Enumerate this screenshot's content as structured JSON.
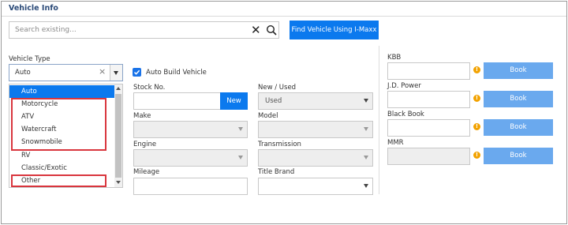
{
  "header": {
    "title": "Vehicle Info"
  },
  "search": {
    "placeholder": "Search existing...",
    "value": "",
    "find_button": "Find Vehicle Using I-Maxx"
  },
  "vehicle_type": {
    "label": "Vehicle Type",
    "selected": "Auto",
    "options": [
      "Auto",
      "Motorcycle",
      "ATV",
      "Watercraft",
      "Snowmobile",
      "RV",
      "Classic/Exotic",
      "Other"
    ]
  },
  "auto_build": {
    "label": "Auto Build Vehicle",
    "checked": true
  },
  "stock_no": {
    "label": "Stock No.",
    "value": "",
    "new_button": "New"
  },
  "new_used": {
    "label": "New / Used",
    "value": "Used"
  },
  "make": {
    "label": "Make",
    "value": ""
  },
  "model": {
    "label": "Model",
    "value": ""
  },
  "engine": {
    "label": "Engine",
    "value": ""
  },
  "transmission": {
    "label": "Transmission",
    "value": ""
  },
  "mileage": {
    "label": "Mileage",
    "value": ""
  },
  "title_brand": {
    "label": "Title Brand",
    "value": ""
  },
  "valuations": [
    {
      "label": "KBB",
      "value": "",
      "button": "Book"
    },
    {
      "label": "J.D. Power",
      "value": "",
      "button": "Book"
    },
    {
      "label": "Black Book",
      "value": "",
      "button": "Book"
    },
    {
      "label": "MMR",
      "value": "",
      "button": "Book"
    }
  ],
  "warning_glyph": "!",
  "colors": {
    "accent": "#0b79ee",
    "book_button": "#6aa9ee",
    "highlight_box": "#d9363e",
    "warning": "#f2a200",
    "header_text": "#2b4a78"
  }
}
